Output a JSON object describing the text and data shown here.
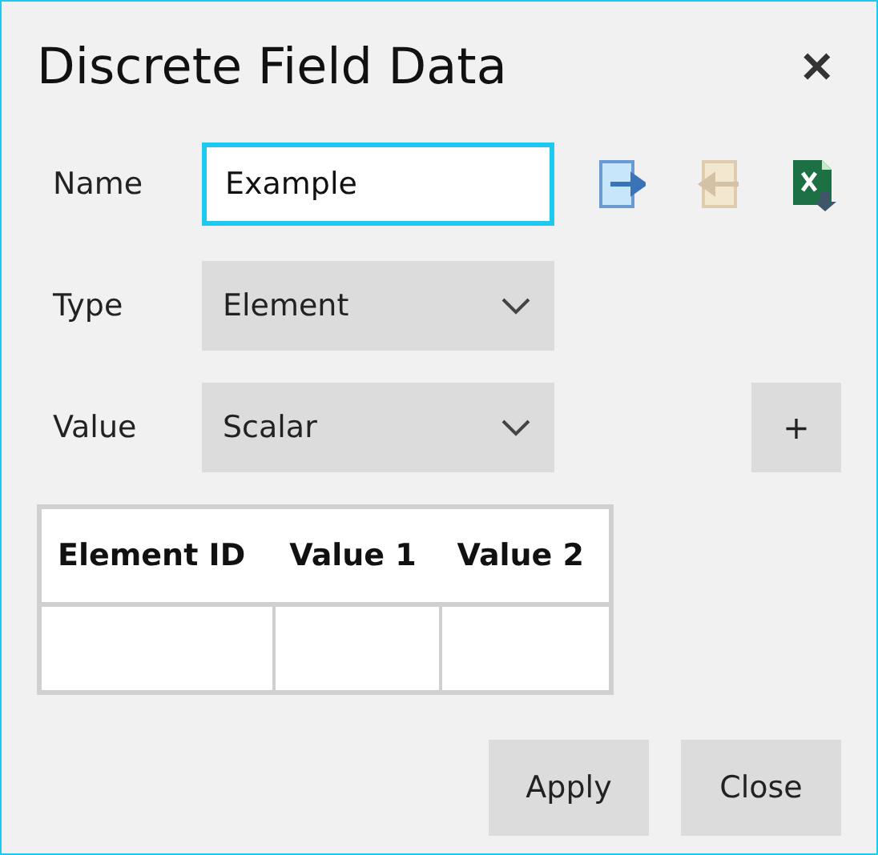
{
  "window": {
    "title": "Discrete Field Data",
    "close": "✕"
  },
  "name": {
    "label": "Name",
    "value": "Example",
    "focused": true
  },
  "tools": [
    {
      "kind": "export",
      "disabled": false
    },
    {
      "kind": "import",
      "disabled": true
    },
    {
      "kind": "excel",
      "disabled": false
    }
  ],
  "type": {
    "label": "Type",
    "value": "Element"
  },
  "value": {
    "label": "Value",
    "value": "Scalar",
    "add": "+"
  },
  "table": {
    "columns": [
      "Element ID",
      "Value 1",
      "Value 2"
    ],
    "rows": [
      [
        "",
        "",
        ""
      ]
    ]
  },
  "buttons": [
    "Apply",
    "Close"
  ]
}
